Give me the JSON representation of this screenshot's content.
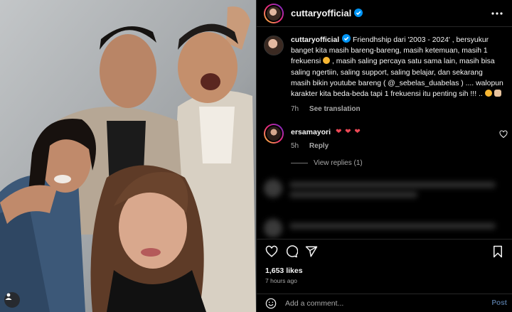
{
  "post": {
    "username": "cuttaryofficial",
    "verified": true
  },
  "caption": {
    "username": "cuttaryofficial",
    "text": "Friendhship dari '2003 - 2024' , bersyukur banget kita masih bareng-bareng, masih ketemuan, masih 1 frekuensi",
    "text2": ", masih saling percaya satu sama lain, masih bisa saling ngertiin, saling support, saling belajar, dan sekarang masih bikin youtube bareng ( @_sebelas_duabelas ) .... walopun karakter kita beda-beda tapi 1 frekuensi itu penting sih !!! ..",
    "time": "7h",
    "see_translation": "See translation"
  },
  "comment": {
    "username": "ersamayori",
    "hearts": "❤ ❤ ❤",
    "time": "5h",
    "reply": "Reply"
  },
  "view_replies": "View replies (1)",
  "likes": "1,653 likes",
  "posted": "7 hours ago",
  "add_comment": {
    "placeholder": "Add a comment...",
    "post_label": "Post"
  },
  "colors": {
    "background": "#000000",
    "text": "#f5f5f5",
    "muted": "#a8a8a8",
    "heart": "#ed4956",
    "verified": "#0095f6",
    "post_button": "#4c6a8f"
  },
  "icons": [
    "more-icon",
    "heart-icon",
    "comment-icon",
    "share-icon",
    "bookmark-icon",
    "emoji-icon",
    "verified-icon",
    "user-tag-icon"
  ]
}
